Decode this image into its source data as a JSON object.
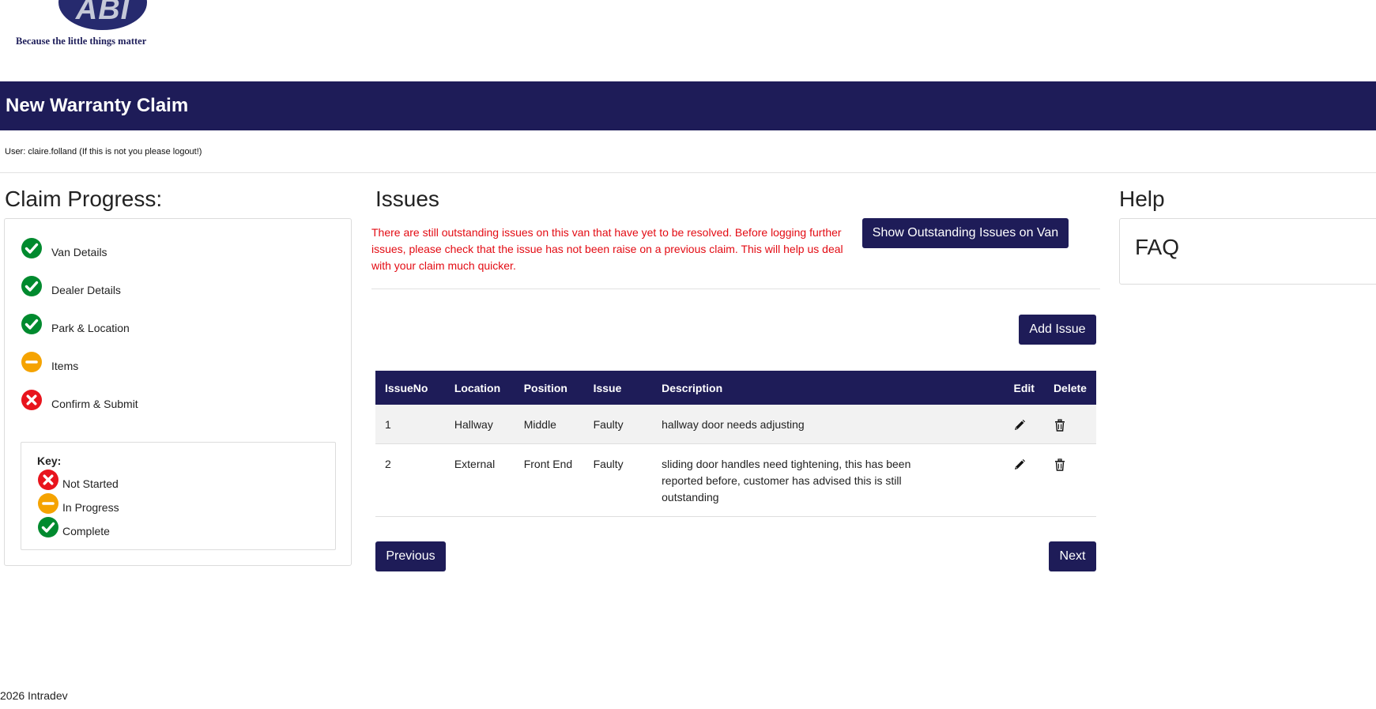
{
  "brand": {
    "logo_text": "ABI",
    "tagline": "Because the little things matter"
  },
  "page": {
    "title": "New Warranty Claim",
    "user_line": "User: claire.folland (If this is not you please logout!)"
  },
  "progress": {
    "heading": "Claim Progress:",
    "steps": [
      {
        "label": "Van Details",
        "status": "complete"
      },
      {
        "label": "Dealer Details",
        "status": "complete"
      },
      {
        "label": "Park & Location",
        "status": "complete"
      },
      {
        "label": "Items",
        "status": "in-progress"
      },
      {
        "label": "Confirm & Submit",
        "status": "not-started"
      }
    ],
    "key": {
      "title": "Key:",
      "items": [
        {
          "label": "Not Started",
          "status": "not-started"
        },
        {
          "label": "In Progress",
          "status": "in-progress"
        },
        {
          "label": "Complete",
          "status": "complete"
        }
      ]
    }
  },
  "issues": {
    "heading": "Issues",
    "warning": "There are still outstanding issues on this van that have yet to be resolved. Before logging further issues, please check that the issue has not been raise on a previous claim. This will help us deal with your claim much quicker.",
    "show_outstanding_label": "Show Outstanding Issues on Van",
    "add_issue_label": "Add Issue",
    "table": {
      "columns": [
        "IssueNo",
        "Location",
        "Position",
        "Issue",
        "Description",
        "Edit",
        "Delete"
      ],
      "rows": [
        {
          "issue_no": "1",
          "location": "Hallway",
          "position": "Middle",
          "issue": "Faulty",
          "description": "hallway door needs adjusting",
          "edit_icon": "pencil-icon",
          "delete_icon": "trash-icon"
        },
        {
          "issue_no": "2",
          "location": "External",
          "position": "Front End",
          "issue": "Faulty",
          "description": "sliding door handles need tightening, this has been reported before, customer has advised this is still outstanding",
          "edit_icon": "pencil-icon",
          "delete_icon": "trash-icon"
        }
      ]
    },
    "previous_label": "Previous",
    "next_label": "Next"
  },
  "help": {
    "heading": "Help",
    "faq": "FAQ"
  },
  "footer": {
    "text": "2026 Intradev"
  },
  "colors": {
    "primary_navy": "#1e1c58",
    "warning_red": "#e30b13",
    "complete_green": "#008a2e",
    "in_progress_orange": "#f5a300",
    "not_started_red": "#e8141d"
  },
  "icons": {
    "complete": "check-circle-icon",
    "in-progress": "minus-circle-icon",
    "not-started": "x-circle-icon"
  }
}
